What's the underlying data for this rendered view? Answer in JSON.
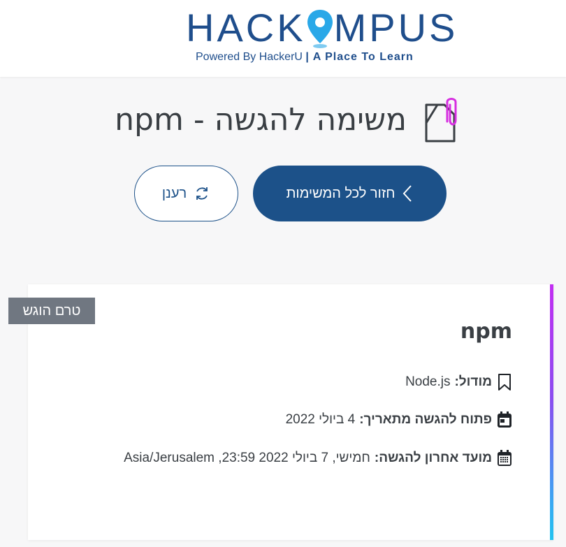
{
  "header": {
    "logo_left": "HACK",
    "logo_right": "MPUS",
    "tagline_powered": "Powered By HackerU ",
    "tagline_divider": "|",
    "tagline_bold": " A Place To Learn",
    "logo_color": "#1f4e8c",
    "pin_color": "#2aa8e8"
  },
  "page": {
    "title": "משימה להגשה - npm",
    "title_icon": "paperclip-document-icon"
  },
  "actions": {
    "back_label": "חזור לכל המשימות",
    "back_icon": "chevron-left-icon",
    "refresh_label": "רענן",
    "refresh_icon": "refresh-icon",
    "primary_color": "#1c5189"
  },
  "task": {
    "status": "טרם הוגש",
    "title": "npm",
    "module_label": "מודול:",
    "module_value": "Node.js",
    "open_label": "פתוח להגשה מתאריך:",
    "open_value": "4 ביולי 2022",
    "deadline_label": "מועד אחרון להגשה:",
    "deadline_value": "חמישי, 7 ביולי 2022 23:59, Asia/Jerusalem",
    "icons": [
      "bookmark-icon",
      "calendar-icon",
      "calendar-grid-icon"
    ]
  }
}
